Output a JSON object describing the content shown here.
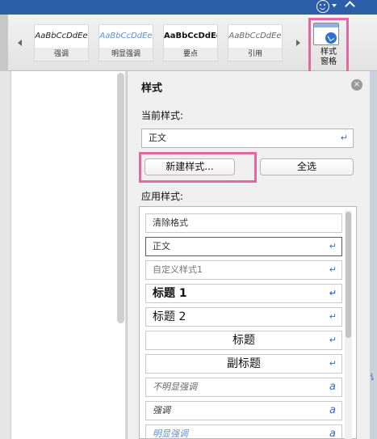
{
  "ribbon": {
    "gallery": [
      {
        "sample": "AaBbCcDdEe",
        "name": "强调",
        "style": "s-emph"
      },
      {
        "sample": "AaBbCcDdEe",
        "name": "明显强调",
        "style": "s-subtle"
      },
      {
        "sample": "AaBbCcDdEe",
        "name": "要点",
        "style": "s-strong"
      },
      {
        "sample": "AaBbCcDdEe",
        "name": "引用",
        "style": "s-quote"
      }
    ],
    "pane_button_label_line1": "样式",
    "pane_button_label_line2": "窗格"
  },
  "pane": {
    "title": "样式",
    "close_glyph": "×",
    "current_label": "当前样式:",
    "current_value": "正文",
    "new_style_button": "新建样式...",
    "select_all_button": "全选",
    "apply_label": "应用样式:",
    "styles": [
      {
        "label": "清除格式",
        "cls": "st-clear",
        "marker": ""
      },
      {
        "label": "正文",
        "cls": "st-normal",
        "marker": "pilcrow"
      },
      {
        "label": "自定义样式1",
        "cls": "st-custom",
        "marker": "pilcrow"
      },
      {
        "label": "标题 1",
        "cls": "st-h1",
        "marker": "pilcrow"
      },
      {
        "label": "标题 2",
        "cls": "st-h2",
        "marker": "pilcrow"
      },
      {
        "label": "标题",
        "cls": "st-title",
        "marker": "pilcrow"
      },
      {
        "label": "副标题",
        "cls": "st-subtitle",
        "marker": "pilcrow"
      },
      {
        "label": "不明显强调",
        "cls": "st-subtle",
        "marker": "a"
      },
      {
        "label": "强调",
        "cls": "st-emph",
        "marker": "a"
      },
      {
        "label": "明显强调",
        "cls": "st-intense",
        "marker": "a"
      }
    ]
  },
  "side_mark": "讠",
  "icons": {
    "pilcrow": "↵",
    "char_mark": "a"
  },
  "colors": {
    "titlebar": "#2c5fa8",
    "highlight": "#e06aa0",
    "accent": "#3b6fc4"
  }
}
